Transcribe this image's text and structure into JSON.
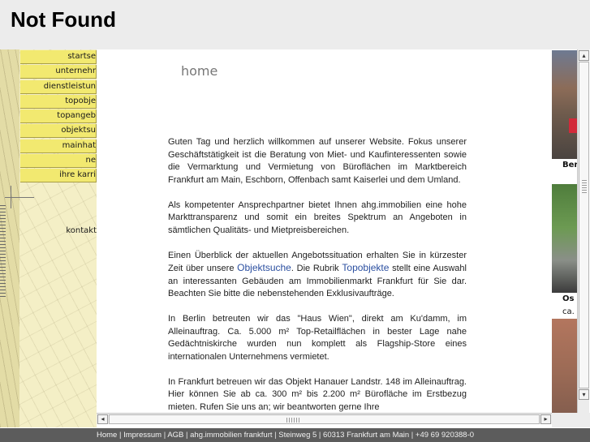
{
  "browser": {
    "error_title": "Not Found"
  },
  "nav": {
    "items": [
      {
        "label": "startse"
      },
      {
        "label": "unternehr"
      },
      {
        "label": "dienstleistun"
      },
      {
        "label": "topobje"
      },
      {
        "label": "topangeb"
      },
      {
        "label": "objektsu"
      },
      {
        "label": "mainhat"
      },
      {
        "label": "ne"
      },
      {
        "label": "ihre karri"
      }
    ],
    "contact": "kontakt"
  },
  "main": {
    "heading": "home",
    "p1": "Guten Tag und herzlich willkommen auf unserer Website. Fokus unserer Geschäftstätigkeit ist die Beratung von Miet- und Kaufinteressenten sowie die Vermarktung und Vermietung von Büroflächen im Marktbereich Frankfurt am Main, Eschborn, Offenbach samt Kaiserlei und dem Umland.",
    "p2": "Als kompetenter Ansprechpartner bietet Ihnen ahg.immobilien eine hohe Markttransparenz und somit ein breites Spektrum an Angeboten in sämtlichen Qualitäts- und Mietpreisbereichen.",
    "p3_a": "Einen Überblick der aktuellen Angebotssituation erhalten Sie in kürzester Zeit über unsere ",
    "p3_link1": "Objektsuche",
    "p3_b": ". Die Rubrik ",
    "p3_link2": "Topobjekte",
    "p3_c": " stellt eine Auswahl an interessanten Gebäuden am Immobilienmarkt Frankfurt für Sie dar. Beachten Sie bitte die nebenstehenden Exklusivaufträge.",
    "p4": "In Berlin betreuten wir das \"Haus Wien\", direkt am Ku'damm, im Alleinauftrag. Ca. 5.000 m² Top-Retailflächen in bester Lage nahe Gedächtniskirche wurden nun komplett als Flagship-Store eines internationalen Unternehmens vermietet.",
    "p5": "In Frankfurt betreuen wir das Objekt Hanauer Landstr. 148 im Alleinauftrag. Hier können Sie ab ca. 300 m² bis 2.200 m² Bürofläche im Erstbezug mieten. Rufen Sie uns an; wir beantworten gerne Ihre"
  },
  "right": {
    "caption1": "Ber",
    "caption2": "Os",
    "caption3": "ca."
  },
  "scroll": {
    "left_arrow": "◂",
    "right_arrow": "▸",
    "up_arrow": "▴",
    "down_arrow": "▾"
  },
  "footer": {
    "home": "Home",
    "impressum": "Impressum",
    "agb": "AGB",
    "company": "ahg.immobilien frankfurt",
    "street": "Steinweg 5",
    "city": "60313 Frankfurt am Main",
    "phone": "+49 69 920388-0",
    "separator": " | "
  }
}
